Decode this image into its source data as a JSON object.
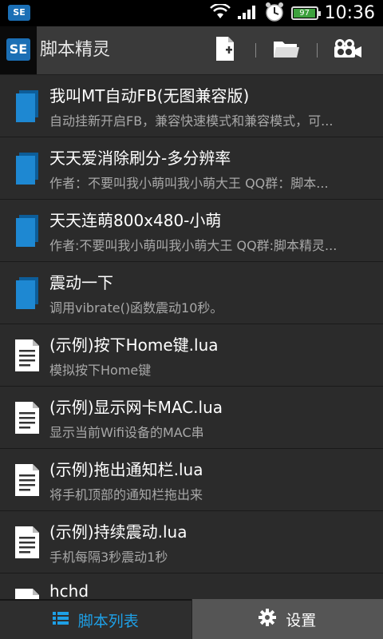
{
  "status_bar": {
    "app_badge": "SE",
    "battery": "97",
    "battery_level": 0.97,
    "time": "10:36",
    "icons": [
      "wifi-icon",
      "signal-icon",
      "alarm-icon",
      "battery-icon"
    ]
  },
  "action_bar": {
    "logo_text": "SE",
    "title": "脚本精灵",
    "icons": [
      "new-file-icon",
      "folder-icon",
      "record-icon"
    ]
  },
  "scripts": [
    {
      "icon": "blue-script-icon",
      "title": "我叫MT自动FB(无图兼容版)",
      "subtitle": "自动挂新开启FB，兼容快速模式和兼容模式，可..."
    },
    {
      "icon": "blue-script-icon",
      "title": "天天爱消除刷分-多分辨率",
      "subtitle": "作者：不要叫我小萌叫我小萌大王 QQ群：脚本..."
    },
    {
      "icon": "blue-script-icon",
      "title": "天天连萌800x480-小萌",
      "subtitle": "作者:不要叫我小萌叫我小萌大王 QQ群:脚本精灵..."
    },
    {
      "icon": "blue-script-icon",
      "title": "震动一下",
      "subtitle": "调用vibrate()函数震动10秒。"
    },
    {
      "icon": "document-icon",
      "title": "(示例)按下Home键.lua",
      "subtitle": "模拟按下Home键"
    },
    {
      "icon": "document-icon",
      "title": "(示例)显示网卡MAC.lua",
      "subtitle": "显示当前Wifi设备的MAC串"
    },
    {
      "icon": "document-icon",
      "title": "(示例)拖出通知栏.lua",
      "subtitle": "将手机顶部的通知栏拖出来"
    },
    {
      "icon": "document-icon",
      "title": "(示例)持续震动.lua",
      "subtitle": "手机每隔3秒震动1秒"
    },
    {
      "icon": "document-icon",
      "title": "hchd",
      "subtitle": ""
    }
  ],
  "bottom_tabs": {
    "script_list": {
      "label": "脚本列表",
      "icon": "list-icon"
    },
    "settings": {
      "label": "设置",
      "icon": "gear-icon"
    }
  },
  "colors": {
    "accent": "#1ea0e6",
    "brand": "#1b6fb5",
    "battery": "#3da13d"
  }
}
